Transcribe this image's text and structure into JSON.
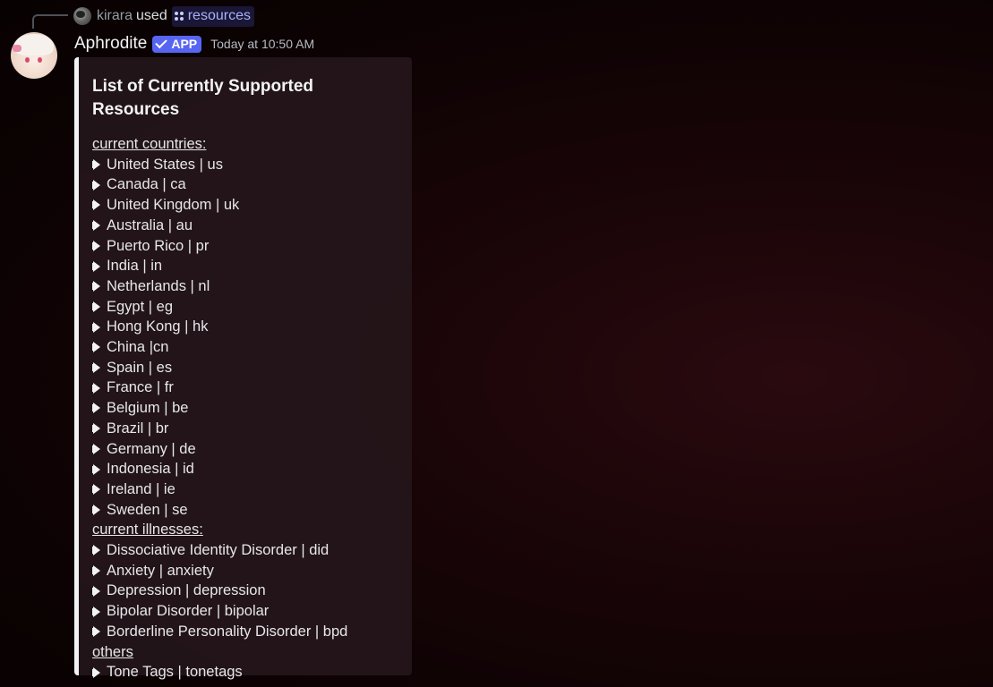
{
  "reply": {
    "user": "kirara",
    "used_text": "used",
    "command": "resources"
  },
  "message": {
    "author": "Aphrodite",
    "badge": "APP",
    "timestamp": "Today at 10:50 AM"
  },
  "embed": {
    "title": "List of Currently Supported Resources",
    "accent_color": "#f2f3f5",
    "countries_heading": "current countries:",
    "countries": [
      "United States | us",
      "Canada | ca",
      "United Kingdom | uk",
      "Australia | au",
      "Puerto Rico | pr",
      "India | in",
      "Netherlands | nl",
      "Egypt | eg",
      "Hong Kong | hk",
      "China |cn",
      "Spain | es",
      "France | fr",
      "Belgium | be",
      "Brazil | br",
      "Germany | de",
      "Indonesia | id",
      "Ireland | ie",
      "Sweden | se"
    ],
    "illnesses_heading": "current illnesses:",
    "illnesses": [
      "Dissociative Identity Disorder | did",
      "Anxiety | anxiety",
      "Depression | depression",
      "Bipolar Disorder | bipolar",
      "Borderline Personality Disorder | bpd"
    ],
    "others_heading": "others",
    "others": [
      "Tone Tags | tonetags"
    ]
  },
  "colors": {
    "badge": "#5865f2",
    "command_chip_text": "#a8b2fb"
  },
  "icons": {
    "bullet": "arrow-right-icon",
    "command": "slash-command-icon",
    "badge_check": "check-icon"
  }
}
